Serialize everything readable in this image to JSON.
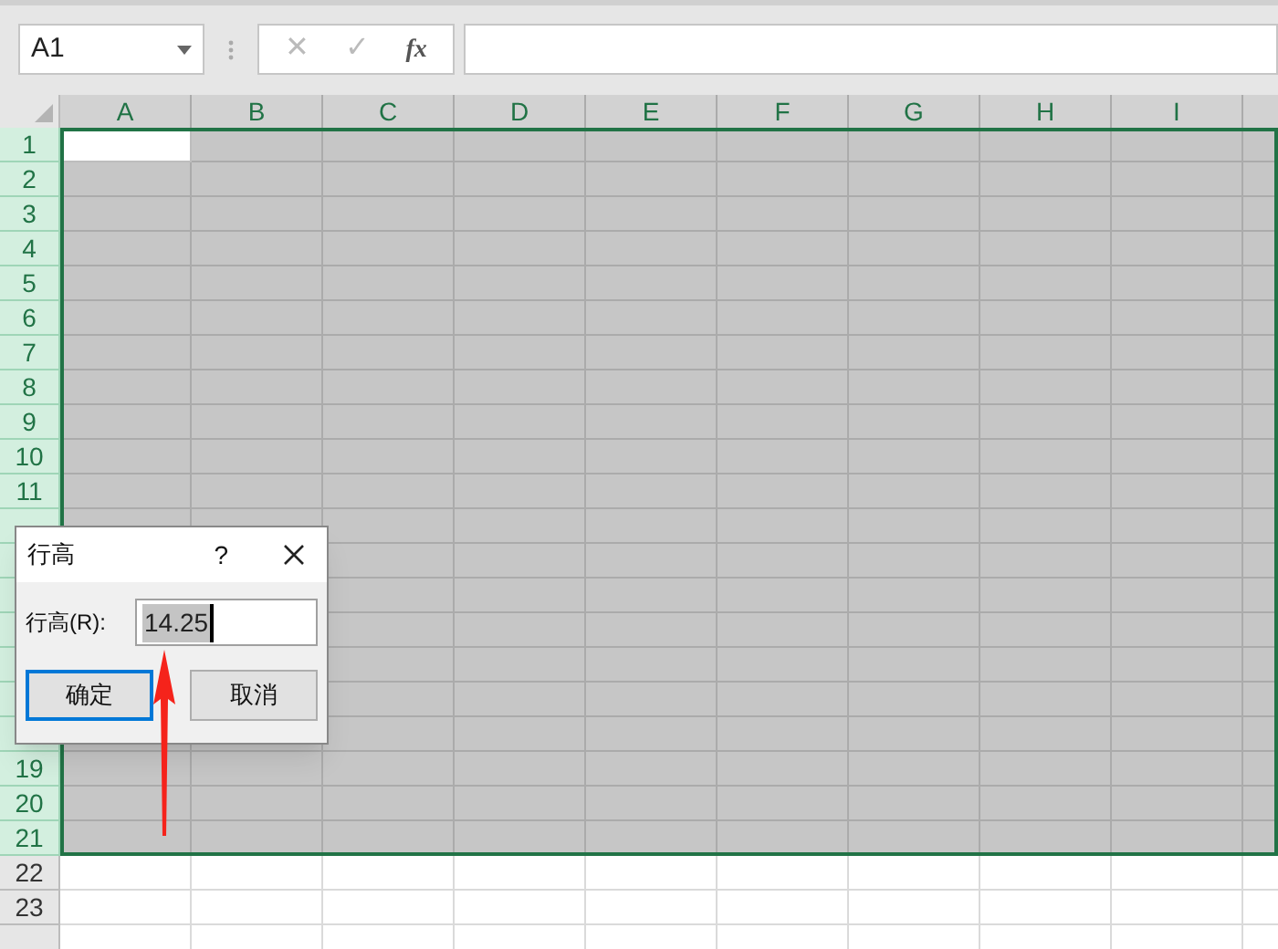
{
  "name_box": {
    "value": "A1"
  },
  "formula_buttons": [
    {
      "label": "✕",
      "kind": "cancel"
    },
    {
      "label": "✓",
      "kind": "enter"
    },
    {
      "label": "fx",
      "kind": "function"
    }
  ],
  "columns": [
    {
      "label": "A",
      "selected": true,
      "active": true
    },
    {
      "label": "B",
      "selected": true,
      "active": false
    },
    {
      "label": "C",
      "selected": true,
      "active": false
    },
    {
      "label": "D",
      "selected": true,
      "active": false
    },
    {
      "label": "E",
      "selected": true,
      "active": false
    },
    {
      "label": "F",
      "selected": true,
      "active": false
    },
    {
      "label": "G",
      "selected": true,
      "active": false
    },
    {
      "label": "H",
      "selected": true,
      "active": false
    },
    {
      "label": "I",
      "selected": true,
      "active": false
    }
  ],
  "rows": [
    {
      "label": "1",
      "selected": true,
      "active": true
    },
    {
      "label": "2",
      "selected": true,
      "active": false
    },
    {
      "label": "3",
      "selected": true,
      "active": false
    },
    {
      "label": "4",
      "selected": true,
      "active": false
    },
    {
      "label": "5",
      "selected": true,
      "active": false
    },
    {
      "label": "6",
      "selected": true,
      "active": false
    },
    {
      "label": "7",
      "selected": true,
      "active": false
    },
    {
      "label": "8",
      "selected": true,
      "active": false
    },
    {
      "label": "9",
      "selected": true,
      "active": false
    },
    {
      "label": "10",
      "selected": true,
      "active": false
    },
    {
      "label": "11",
      "selected": true,
      "active": false
    },
    {
      "selected": true,
      "active": false
    },
    {
      "selected": true,
      "active": false
    },
    {
      "selected": true,
      "active": false
    },
    {
      "selected": true,
      "active": false
    },
    {
      "selected": true,
      "active": false
    },
    {
      "selected": true,
      "active": false
    },
    {
      "selected": true,
      "active": false
    },
    {
      "label": "19",
      "selected": true,
      "active": false
    },
    {
      "label": "20",
      "selected": true,
      "active": false
    },
    {
      "label": "21",
      "selected": true,
      "active": false
    },
    {
      "label": "22",
      "selected": false,
      "active": false
    },
    {
      "label": "23",
      "selected": false,
      "active": false
    },
    {
      "selected": false,
      "active": false
    }
  ],
  "dialog": {
    "title": "行高",
    "help": "?",
    "field_label": "行高(R):",
    "value": "14.25",
    "buttons": [
      {
        "label": "确定",
        "default": true
      },
      {
        "label": "取消",
        "default": false
      }
    ]
  }
}
